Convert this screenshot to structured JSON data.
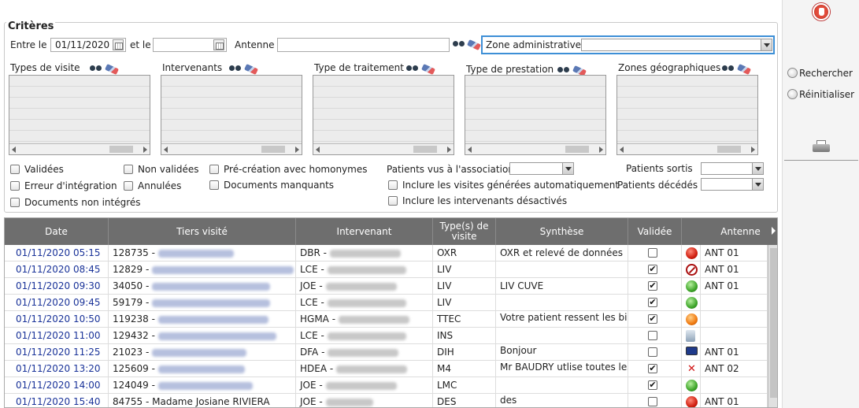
{
  "criteria": {
    "legend": "Critères",
    "entre_label": "Entre le",
    "date_from": "01/11/2020",
    "et_label": "et le",
    "date_to": "",
    "antenne_label": "Antenne",
    "antenne_value": "",
    "zone_label": "Zone administrative",
    "zone_value": "",
    "lists": [
      {
        "label": "Types de visite"
      },
      {
        "label": "Intervenants"
      },
      {
        "label": "Type de traitement"
      },
      {
        "label": "Type de prestation"
      },
      {
        "label": "Zones géographiques"
      }
    ],
    "checkboxes": {
      "validees": "Validées",
      "non_validees": "Non validées",
      "pre_creation": "Pré-création avec homonymes",
      "erreur": "Erreur d'intégration",
      "annulees": "Annulées",
      "docs_manquants": "Documents manquants",
      "docs_non_integres": "Documents non intégrés",
      "inclure_auto": "Inclure les visites générées automatiquement",
      "inclure_desactives": "Inclure les intervenants désactivés"
    },
    "patients_vus_label": "Patients vus à l'association",
    "patients_sortis_label": "Patients sortis",
    "patients_decedes_label": "Patients décédés"
  },
  "actions": {
    "rechercher": "Rechercher",
    "reinitialiser": "Réinitialiser"
  },
  "grid": {
    "columns": [
      "Date",
      "Tiers visité",
      "Intervenant",
      "Type(s) de visite",
      "Synthèse",
      "Validée",
      "Antenne"
    ],
    "rows": [
      {
        "date": "01/11/2020 05:15",
        "tiers": "128735 -",
        "interv": "DBR -",
        "type": "OXR",
        "synth": "OXR et relevé de données",
        "valid": false,
        "status": "red",
        "antenne": "ANT 01"
      },
      {
        "date": "01/11/2020 08:45",
        "tiers": "12829 -",
        "interv": "LCE -",
        "type": "LIV",
        "synth": "",
        "valid": true,
        "status": "forbidden",
        "antenne": "ANT 01"
      },
      {
        "date": "01/11/2020 09:30",
        "tiers": "34050 -",
        "interv": "JOE -",
        "type": "LIV",
        "synth": "LIV CUVE",
        "valid": true,
        "status": "green",
        "antenne": "ANT 01"
      },
      {
        "date": "01/11/2020 09:45",
        "tiers": "59179 -",
        "interv": "LCE -",
        "type": "LIV",
        "synth": "",
        "valid": true,
        "status": "green",
        "antenne": ""
      },
      {
        "date": "01/11/2020 10:50",
        "tiers": "119238 -",
        "interv": "HGMA -",
        "type": "TTEC",
        "synth": "Votre patient ressent les bie",
        "valid": true,
        "status": "orange",
        "antenne": ""
      },
      {
        "date": "01/11/2020 11:00",
        "tiers": "129432 -",
        "interv": "LCE -",
        "type": "INS",
        "synth": "",
        "valid": false,
        "status": "doc",
        "antenne": ""
      },
      {
        "date": "01/11/2020 11:25",
        "tiers": "21023 -",
        "interv": "DFA -",
        "type": "DIH",
        "synth": "Bonjour",
        "valid": false,
        "status": "pc",
        "antenne": "ANT 01"
      },
      {
        "date": "01/11/2020 13:20",
        "tiers": "125609 -",
        "interv": "HDEA -",
        "type": "M4",
        "synth": "Mr BAUDRY utlise toutes les",
        "valid": true,
        "status": "cross",
        "antenne": "ANT 02"
      },
      {
        "date": "01/11/2020 14:00",
        "tiers": "124049 -",
        "interv": "JOE -",
        "type": "LMC",
        "synth": "",
        "valid": true,
        "status": "green",
        "antenne": ""
      },
      {
        "date": "01/11/2020 15:40",
        "tiers": "84755 - Madame Josiane RIVIERA",
        "interv": "JOE -",
        "type": "DES",
        "synth": "des",
        "valid": false,
        "status": "red",
        "antenne": "ANT 01"
      }
    ]
  },
  "colors": {
    "accent": "#3d8fd6",
    "header": "#6e6e6e",
    "link": "#1a3399"
  }
}
